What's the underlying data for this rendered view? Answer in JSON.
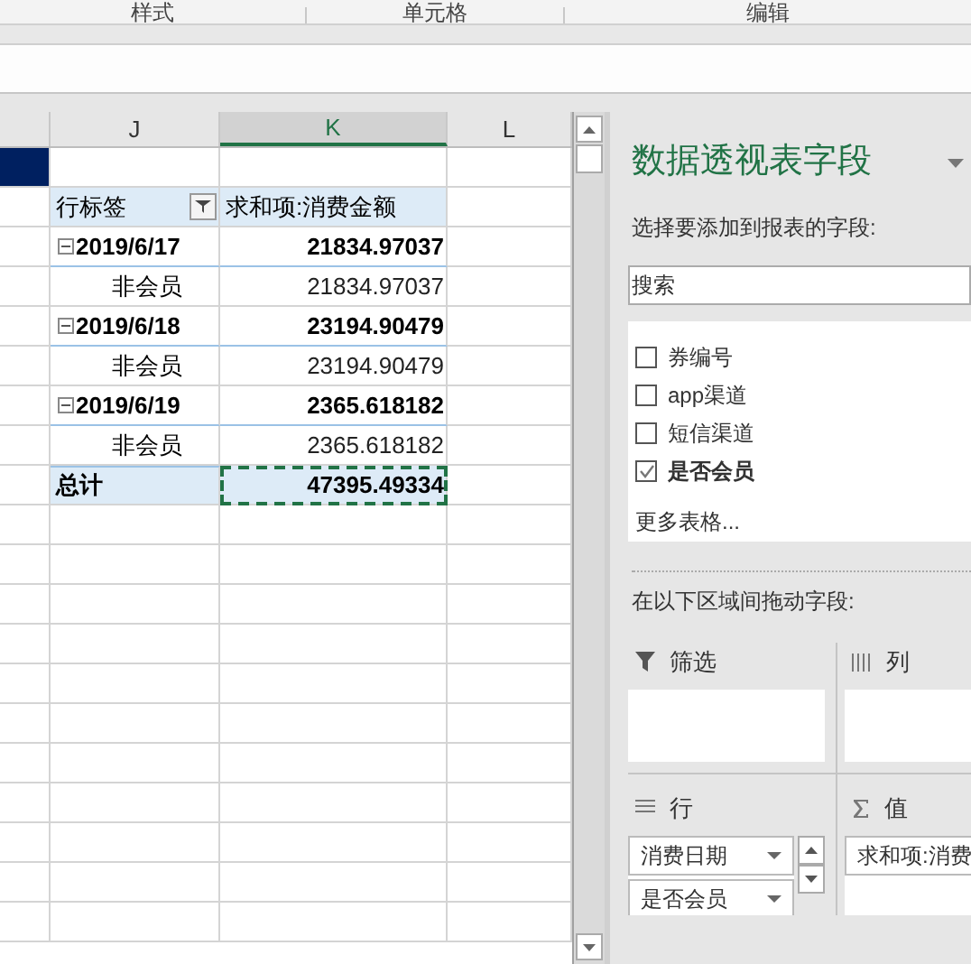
{
  "ribbon_groups": [
    "样式",
    "单元格",
    "编辑"
  ],
  "columns": [
    {
      "label": "J",
      "selected": false
    },
    {
      "label": "K",
      "selected": true
    },
    {
      "label": "L",
      "selected": false
    }
  ],
  "pivot": {
    "row_label": "行标签",
    "value_label": "求和项:消费金额",
    "rows": [
      {
        "kind": "group",
        "label": "2019/6/17",
        "value": "21834.97037",
        "expanded": true,
        "selected": false
      },
      {
        "kind": "item",
        "label": "非会员",
        "value": "21834.97037",
        "selected": false
      },
      {
        "kind": "group",
        "label": "2019/6/18",
        "value": "23194.90479",
        "expanded": true,
        "selected": false
      },
      {
        "kind": "item",
        "label": "非会员",
        "value": "23194.90479",
        "selected": false
      },
      {
        "kind": "group",
        "label": "2019/6/19",
        "value": "2365.618182",
        "expanded": true,
        "selected": false
      },
      {
        "kind": "item",
        "label": "非会员",
        "value": "2365.618182",
        "selected": false
      },
      {
        "kind": "total",
        "label": "总计",
        "value": "47395.49334",
        "selected": true
      }
    ]
  },
  "field_panel": {
    "title": "数据透视表字段",
    "subtitle": "选择要添加到报表的字段:",
    "search": {
      "placeholder": "搜索"
    },
    "fields": [
      {
        "label": "券编号",
        "checked": false
      },
      {
        "label": "app渠道",
        "checked": false
      },
      {
        "label": "短信渠道",
        "checked": false
      },
      {
        "label": "是否会员",
        "checked": true
      }
    ],
    "more_tables": "更多表格...",
    "areas_label": "在以下区域间拖动字段:",
    "areas": [
      {
        "kind": "filter",
        "label": "筛选"
      },
      {
        "kind": "columns",
        "label": "列"
      },
      {
        "kind": "rows",
        "label": "行",
        "items": [
          "消费日期",
          "是否会员"
        ]
      },
      {
        "kind": "values",
        "label": "值",
        "items": [
          "求和项:消费"
        ]
      }
    ]
  }
}
